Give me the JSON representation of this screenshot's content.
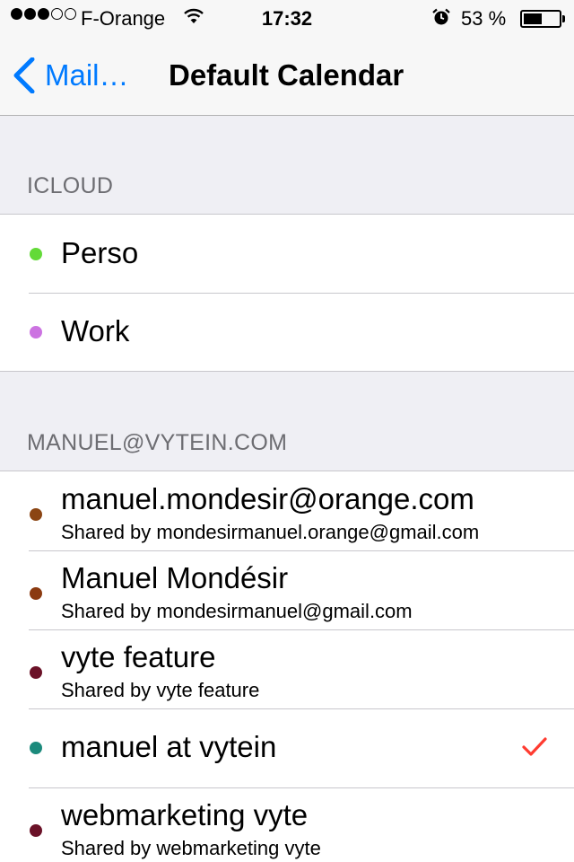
{
  "status_bar": {
    "carrier": "F-Orange",
    "time": "17:32",
    "battery_percent": "53 %",
    "battery_level": 0.53,
    "signal_bars_filled": 3,
    "signal_bars_total": 5
  },
  "nav": {
    "back_label": "Mail…",
    "title": "Default Calendar"
  },
  "sections": [
    {
      "header": "ICLOUD",
      "items": [
        {
          "name": "Perso",
          "subtitle": "",
          "color": "#63da38",
          "selected": false
        },
        {
          "name": "Work",
          "subtitle": "",
          "color": "#cc73e1",
          "selected": false
        }
      ]
    },
    {
      "header": "MANUEL@VYTEIN.COM",
      "items": [
        {
          "name": "manuel.mondesir@orange.com",
          "subtitle": "Shared by mondesirmanuel.orange@gmail.com",
          "color": "#8b4513",
          "selected": false
        },
        {
          "name": "Manuel Mondésir",
          "subtitle": "Shared by mondesirmanuel@gmail.com",
          "color": "#8b3a10",
          "selected": false
        },
        {
          "name": "vyte feature",
          "subtitle": "Shared by vyte feature",
          "color": "#6b1228",
          "selected": false
        },
        {
          "name": "manuel at vytein",
          "subtitle": "",
          "color": "#1b8a7c",
          "selected": true
        },
        {
          "name": "webmarketing vyte",
          "subtitle": "Shared by webmarketing vyte",
          "color": "#6b1228",
          "selected": false
        }
      ]
    }
  ],
  "colors": {
    "accent": "#007aff",
    "checkmark": "#ff3b30"
  }
}
